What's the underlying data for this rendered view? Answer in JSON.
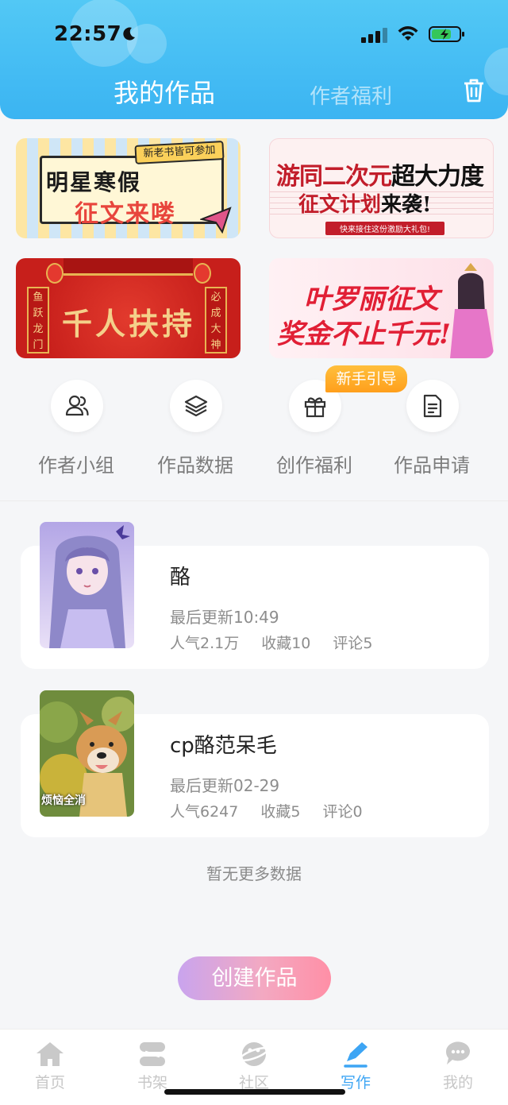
{
  "status_bar": {
    "time": "22:57"
  },
  "header": {
    "tab_active": "我的作品",
    "tab_other": "作者福利"
  },
  "banners": {
    "b1": {
      "tag": "新老书皆可参加",
      "line1": "明星寒假",
      "line2": "征文来喽"
    },
    "b2": {
      "line1_a": "游同二次元",
      "line1_b": "超大力度",
      "line2_a": "征文计划",
      "line2_b": "来袭!",
      "line3": "快来接住这份激励大礼包!"
    },
    "b3": {
      "side_left": "鱼跃龙门",
      "side_right": "必成大神",
      "main": "千人扶持"
    },
    "b4": {
      "line1": "叶罗丽征文",
      "line2": "奖金不止千元!"
    }
  },
  "quick_menu": {
    "badge": "新手引导",
    "items": [
      {
        "label": "作者小组",
        "icon": "users-icon"
      },
      {
        "label": "作品数据",
        "icon": "layers-icon"
      },
      {
        "label": "创作福利",
        "icon": "gift-icon"
      },
      {
        "label": "作品申请",
        "icon": "document-icon"
      }
    ]
  },
  "works": [
    {
      "title": "酪",
      "updated": "最后更新10:49",
      "popularity": "人气2.1万",
      "favorites": "收藏10",
      "comments": "评论5"
    },
    {
      "title": "cp酪范呆毛",
      "updated": "最后更新02-29",
      "popularity": "人气6247",
      "favorites": "收藏5",
      "comments": "评论0",
      "cover_caption": "烦恼全消"
    }
  ],
  "no_more": "暂无更多数据",
  "create_button": "创建作品",
  "bottom_nav": [
    {
      "label": "首页",
      "icon": "home-icon",
      "active": false
    },
    {
      "label": "书架",
      "icon": "bookshelf-icon",
      "active": false
    },
    {
      "label": "社区",
      "icon": "community-icon",
      "active": false
    },
    {
      "label": "写作",
      "icon": "pen-icon",
      "active": true
    },
    {
      "label": "我的",
      "icon": "profile-chat-icon",
      "active": false
    }
  ],
  "colors": {
    "header": "#3bb4f2",
    "accent": "#3da5f4",
    "badge": "#ff9f1c"
  }
}
